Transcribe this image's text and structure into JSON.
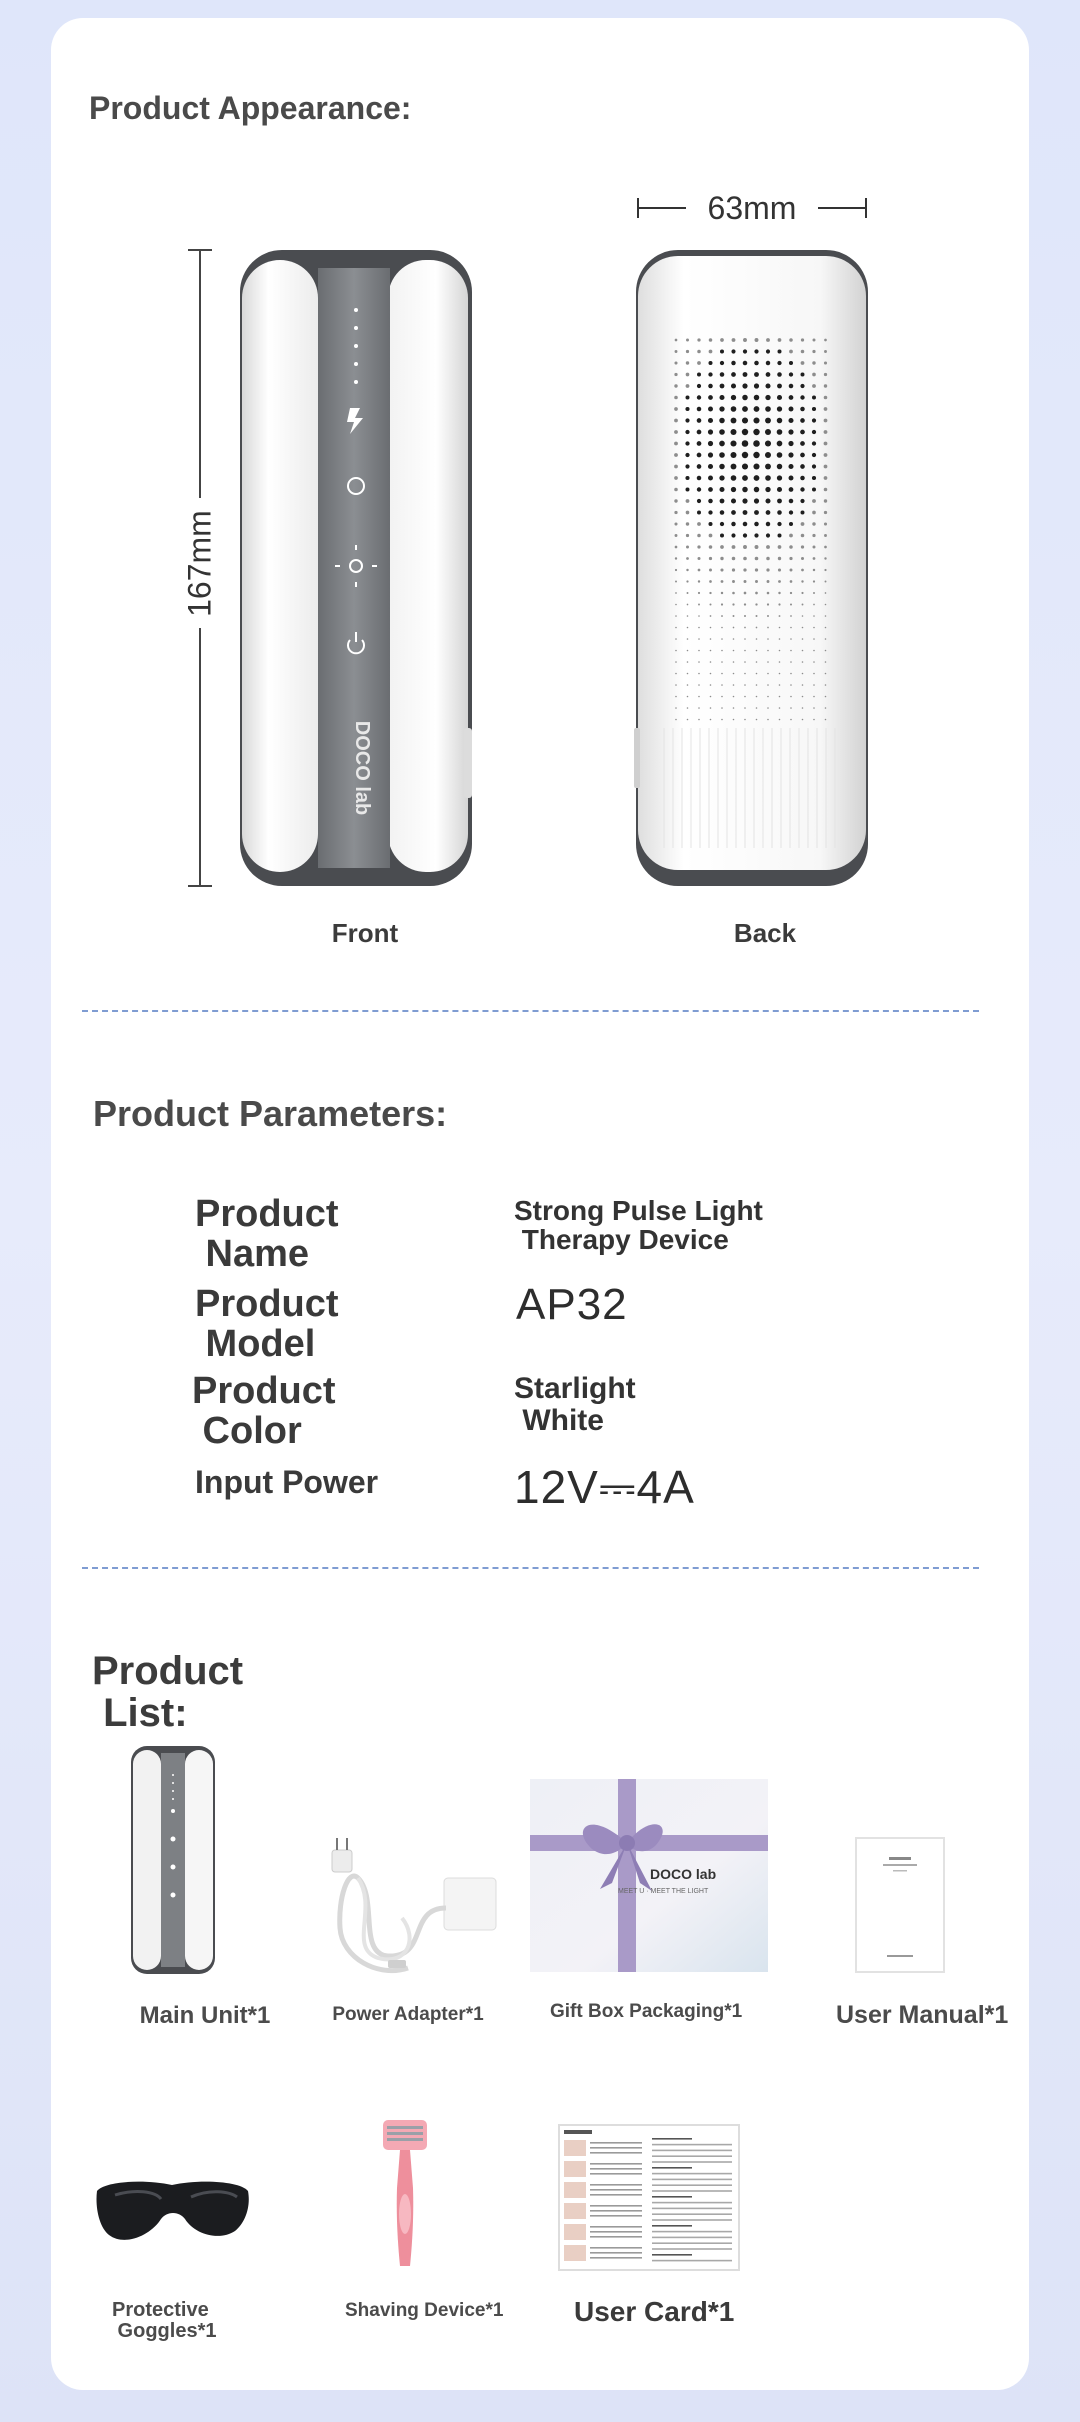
{
  "appearance": {
    "title": "Product Appearance:",
    "dim_width": "63mm",
    "dim_height": "167mm",
    "front_label": "Front",
    "back_label": "Back",
    "device_logo": "DOCO lab"
  },
  "parameters": {
    "title": "Product Parameters:",
    "rows": [
      {
        "name": "Product\n Name",
        "value": "Strong Pulse Light\n Therapy Device"
      },
      {
        "name": "Product\n Model",
        "value": "AP32"
      },
      {
        "name": "Product\n Color",
        "value": "Starlight\n White"
      },
      {
        "name": "Input Power",
        "value": "12V⎓4A"
      }
    ]
  },
  "product_list": {
    "title": "Product\n List:",
    "items": [
      {
        "label": "Main Unit*1",
        "icon": "device-icon"
      },
      {
        "label": "Power Adapter*1",
        "icon": "adapter-icon"
      },
      {
        "label": "Gift Box Packaging*1",
        "icon": "gift-box-icon"
      },
      {
        "label": "User Manual*1",
        "icon": "manual-icon"
      },
      {
        "label": "Protective\n Goggles*1",
        "icon": "goggles-icon"
      },
      {
        "label": "Shaving Device*1",
        "icon": "razor-icon"
      },
      {
        "label": "User Card*1",
        "icon": "card-icon"
      }
    ]
  },
  "colors": {
    "background": "#e1e7fa",
    "card": "#ffffff",
    "separator": "#7f9cd2",
    "ribbon": "#a99ac8"
  }
}
